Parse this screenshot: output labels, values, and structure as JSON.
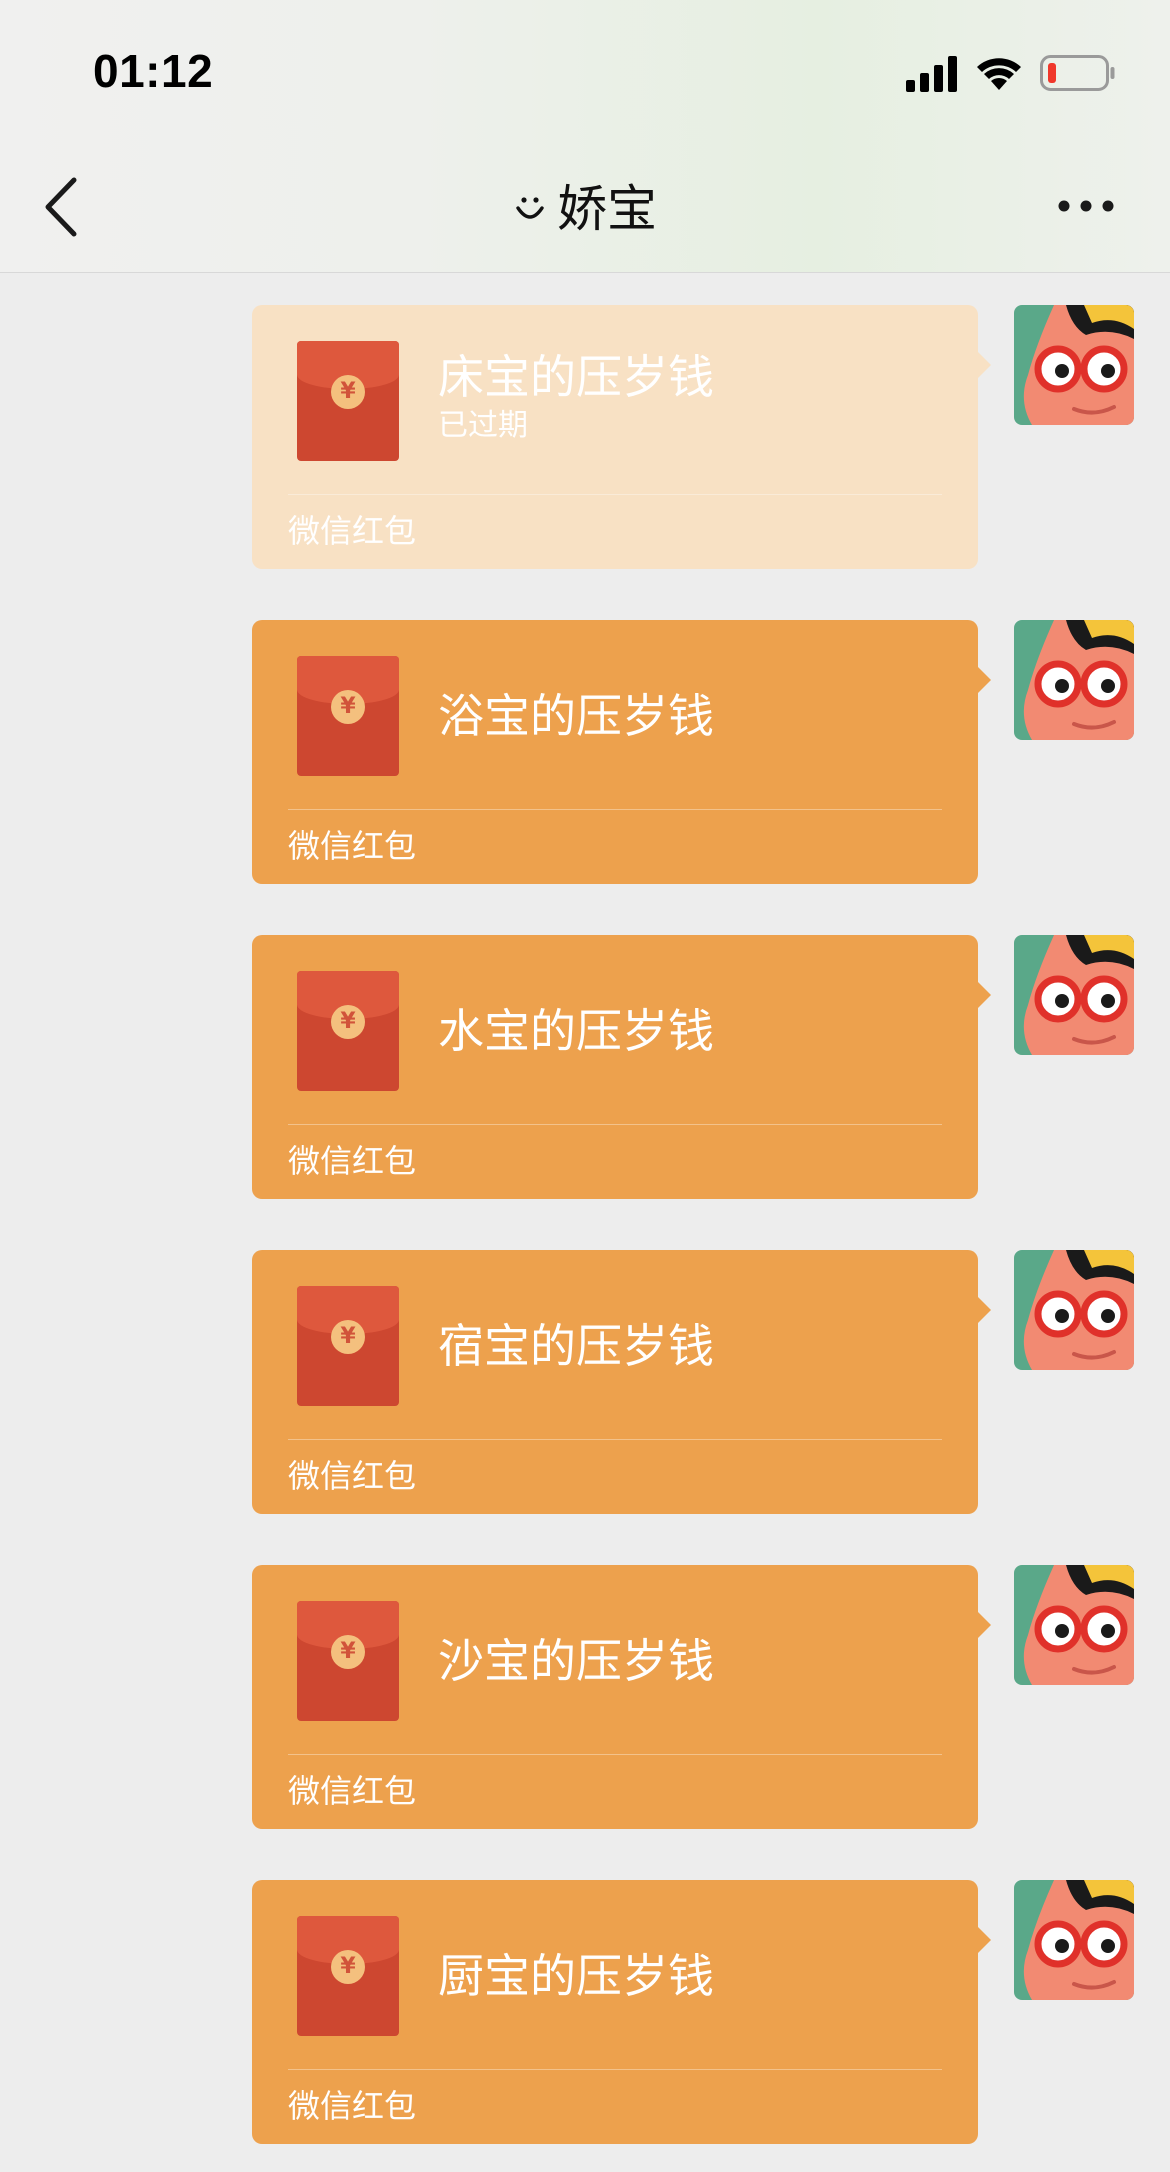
{
  "status_bar": {
    "time": "01:12"
  },
  "nav": {
    "title": "娇宝",
    "back_icon": "chevron-left-icon",
    "more_icon": "ellipsis-icon",
    "title_prefix_icon": "smile-icon"
  },
  "messages": [
    {
      "title": "床宝的压岁钱",
      "status": "已过期",
      "footer": "微信红包",
      "expired": true
    },
    {
      "title": "浴宝的压岁钱",
      "status": "",
      "footer": "微信红包",
      "expired": false
    },
    {
      "title": "水宝的压岁钱",
      "status": "",
      "footer": "微信红包",
      "expired": false
    },
    {
      "title": "宿宝的压岁钱",
      "status": "",
      "footer": "微信红包",
      "expired": false
    },
    {
      "title": "沙宝的压岁钱",
      "status": "",
      "footer": "微信红包",
      "expired": false
    },
    {
      "title": "厨宝的压岁钱",
      "status": "",
      "footer": "微信红包",
      "expired": false
    }
  ],
  "red_packet": {
    "coin_symbol": "¥"
  },
  "colors": {
    "bubble": "#eda14d",
    "bubble_expired": "#f8e1c4",
    "envelope": "#cd4730",
    "background": "#ededed"
  }
}
